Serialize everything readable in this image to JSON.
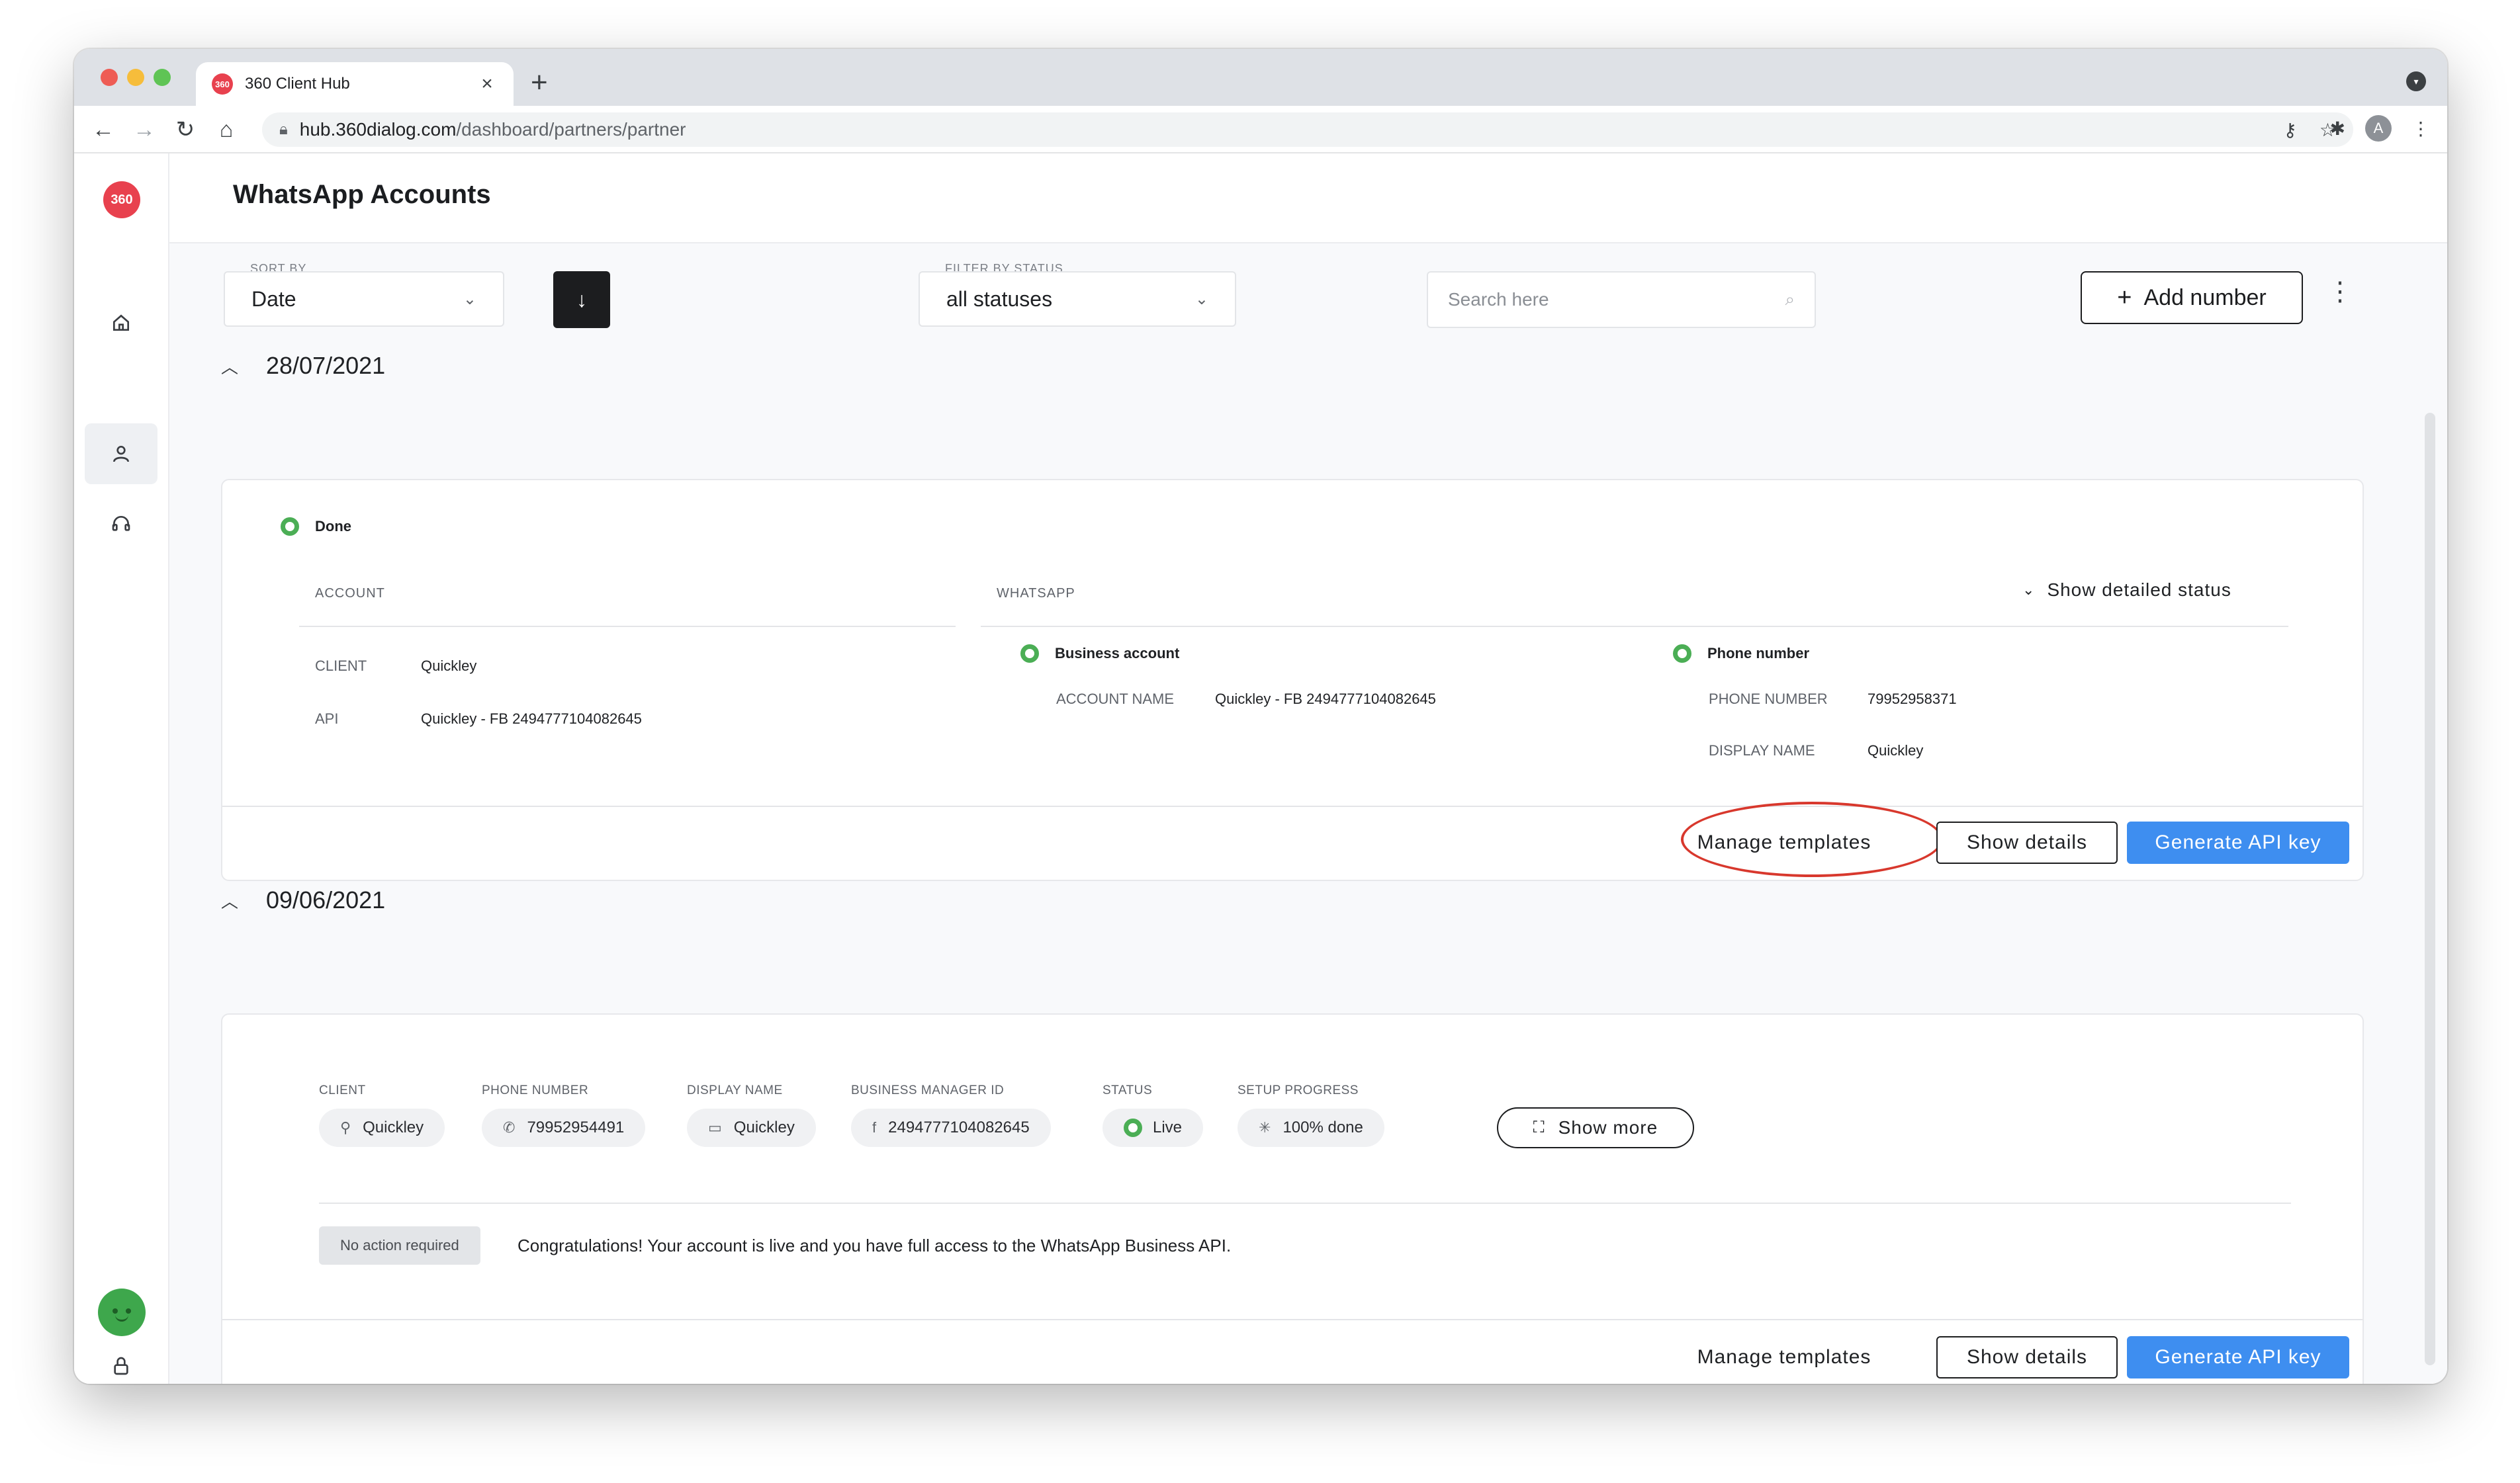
{
  "browser": {
    "tab_title": "360 Client Hub",
    "favicon_text": "360",
    "url_host": "hub.360dialog.com",
    "url_path": "/dashboard/partners/partner",
    "profile_initial": "A"
  },
  "app": {
    "logo_text": "360",
    "page_title": "WhatsApp Accounts"
  },
  "controls": {
    "sort_label": "SORT BY",
    "sort_value": "Date",
    "filter_label": "FILTER BY STATUS",
    "filter_value": "all statuses",
    "search_placeholder": "Search here",
    "add_number": "Add number"
  },
  "group1": {
    "date": "28/07/2021",
    "status": "Done",
    "account_heading": "ACCOUNT",
    "whatsapp_heading": "WHATSAPP",
    "show_detailed_status": "Show detailed status",
    "client_key": "CLIENT",
    "client_val": "Quickley",
    "api_key": "API",
    "api_val": "Quickley - FB 2494777104082645",
    "business_account": "Business account",
    "account_name_key": "ACCOUNT NAME",
    "account_name_val": "Quickley - FB 2494777104082645",
    "phone_number_title": "Phone number",
    "phone_number_key": "PHONE NUMBER",
    "phone_number_val": "79952958371",
    "display_name_key": "DISPLAY NAME",
    "display_name_val": "Quickley",
    "manage_templates": "Manage templates",
    "show_details": "Show details",
    "generate_api_key": "Generate API key"
  },
  "group2": {
    "date": "09/06/2021",
    "columns": {
      "client": "CLIENT",
      "phone_number": "PHONE NUMBER",
      "display_name": "DISPLAY NAME",
      "business_manager_id": "BUSINESS MANAGER ID",
      "status": "STATUS",
      "setup_progress": "SETUP PROGRESS"
    },
    "values": {
      "client": "Quickley",
      "phone_number": "79952954491",
      "display_name": "Quickley",
      "business_manager_id": "2494777104082645",
      "status": "Live",
      "setup_progress": "100% done"
    },
    "show_more": "Show more",
    "action_badge": "No action required",
    "message": "Congratulations! Your account is live and you have full access to the WhatsApp Business API.",
    "manage_templates": "Manage templates",
    "show_details": "Show details",
    "generate_api_key": "Generate API key"
  },
  "colors": {
    "brand": "#e8414e",
    "primary": "#3e8ef0",
    "status_green": "#4bae55",
    "annotation_red": "#d8382d"
  },
  "icons": {
    "sidebar": [
      "home-icon",
      "user-icon",
      "headset-icon",
      "lock-icon"
    ]
  }
}
